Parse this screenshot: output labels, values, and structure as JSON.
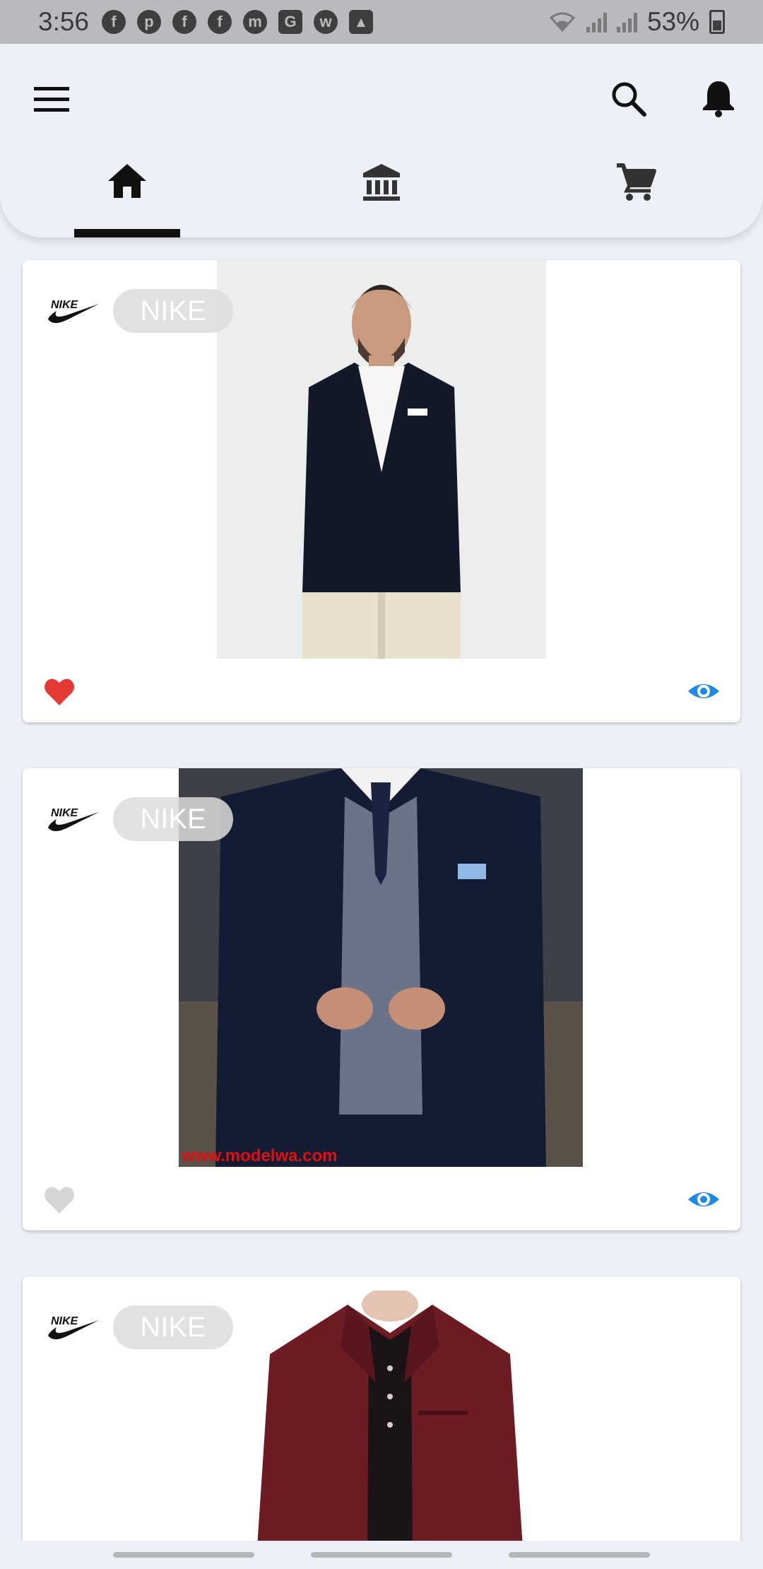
{
  "status_bar": {
    "time": "3:56",
    "notifications": [
      "facebook-icon",
      "pinterest-icon",
      "facebook-icon",
      "facebook-icon",
      "messenger-icon",
      "translate-icon",
      "whatsapp-icon",
      "gallery-icon"
    ],
    "battery": "53%"
  },
  "app_bar": {
    "icons": {
      "menu": "menu-icon",
      "search": "search-icon",
      "notifications": "bell-icon"
    },
    "tabs": [
      {
        "icon": "home-icon",
        "active": true
      },
      {
        "icon": "bank-icon",
        "active": false
      },
      {
        "icon": "cart-icon",
        "active": false
      }
    ]
  },
  "products": [
    {
      "brand": "NIKE",
      "liked": true
    },
    {
      "brand": "NIKE",
      "liked": false,
      "watermark": "www.modelwa.com"
    },
    {
      "brand": "NIKE",
      "liked": false
    }
  ],
  "colors": {
    "background": "#eef0f7",
    "like_active": "#e53935",
    "like_inactive": "#d6d6d6",
    "eye": "#1e88e5",
    "tab_indicator": "#111111"
  }
}
